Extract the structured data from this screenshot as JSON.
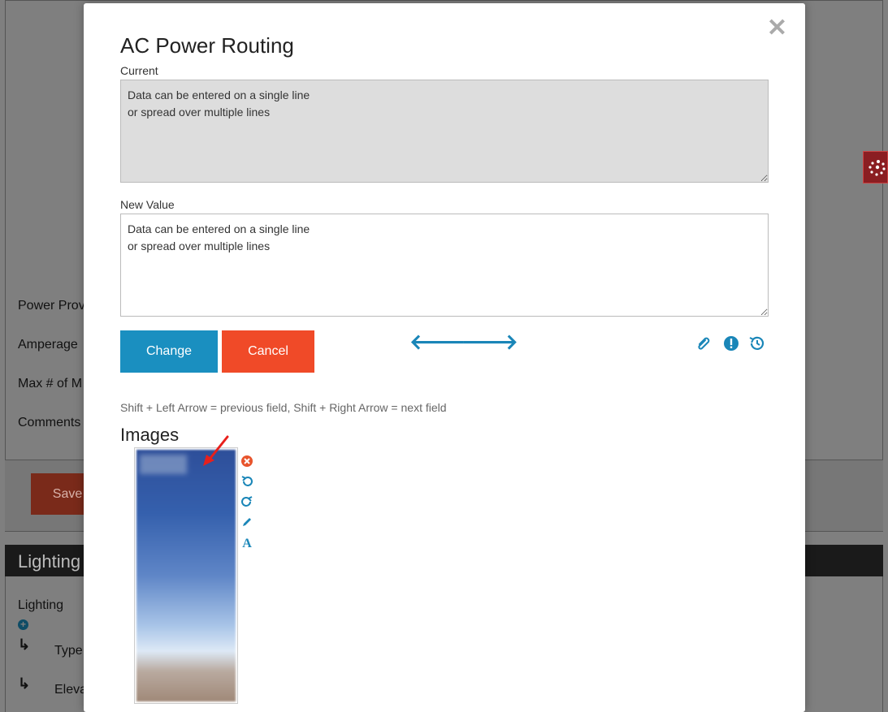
{
  "background": {
    "labels": [
      "Power Prov",
      "Amperage",
      "Max # of M",
      "Comments"
    ],
    "save_label": "Save",
    "section_title": "Lighting",
    "lighting_label": "Lighting",
    "sub_items": [
      "Type",
      "Eleva"
    ]
  },
  "modal": {
    "title": "AC Power Routing",
    "current_label": "Current",
    "current_value": "Data can be entered on a single line\nor spread over multiple lines",
    "new_label": "New Value",
    "new_value": "Data can be entered on a single line\nor spread over multiple lines",
    "change_label": "Change",
    "cancel_label": "Cancel",
    "hint": "Shift + Left Arrow = previous field, Shift + Right Arrow = next field",
    "images_title": "Images",
    "icons": {
      "close": "close-icon",
      "prev": "arrow-left-icon",
      "next": "arrow-right-icon",
      "attach": "paperclip-icon",
      "alert": "exclamation-icon",
      "history": "history-icon",
      "image_tools": [
        "delete-icon",
        "rotate-left-icon",
        "rotate-right-icon",
        "pencil-icon",
        "text-icon"
      ]
    },
    "colors": {
      "primary": "#1a8fc0",
      "danger": "#f04a28",
      "icon_blue": "#1a86b8"
    }
  }
}
